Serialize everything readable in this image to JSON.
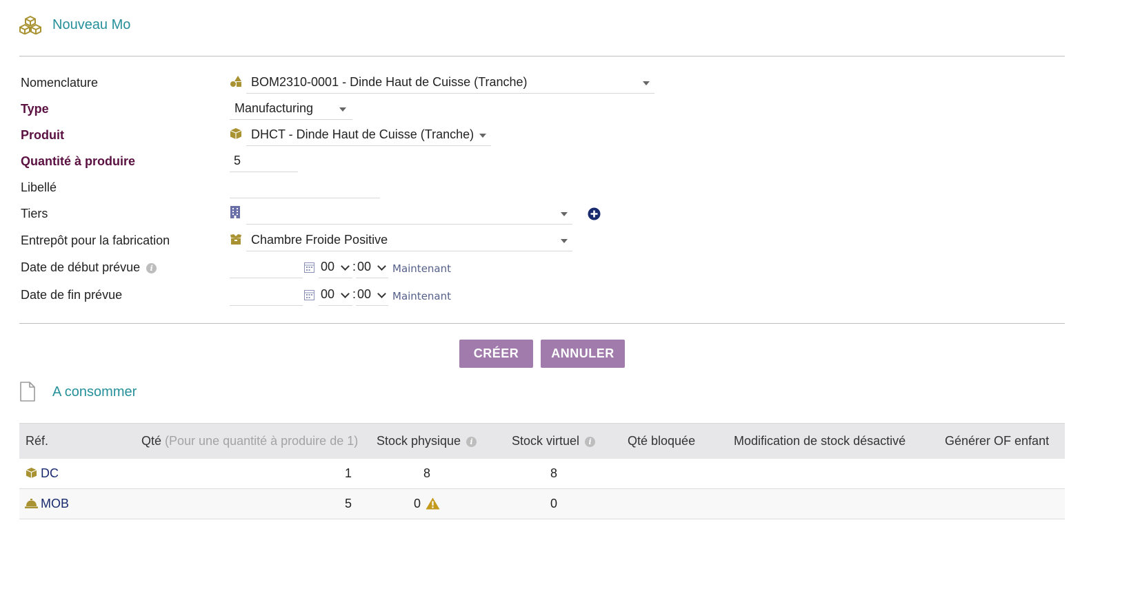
{
  "header": {
    "title": "Nouveau Mo"
  },
  "form": {
    "nomenclature": {
      "label": "Nomenclature",
      "value": "BOM2310-0001 - Dinde Haut de Cuisse (Tranche)"
    },
    "type": {
      "label": "Type",
      "value": "Manufacturing"
    },
    "produit": {
      "label": "Produit",
      "value": "DHCT - Dinde Haut de Cuisse (Tranche)"
    },
    "quantite": {
      "label": "Quantité à produire",
      "value": "5"
    },
    "libelle": {
      "label": "Libellé",
      "value": ""
    },
    "tiers": {
      "label": "Tiers",
      "value": ""
    },
    "entrepot": {
      "label": "Entrepôt pour la fabrication",
      "value": "Chambre Froide Positive"
    },
    "date_debut": {
      "label": "Date de début prévue",
      "hour": "00",
      "minute": "00",
      "now_label": "Maintenant"
    },
    "date_fin": {
      "label": "Date de fin prévue",
      "hour": "00",
      "minute": "00",
      "now_label": "Maintenant"
    }
  },
  "buttons": {
    "create": "CRÉER",
    "cancel": "ANNULER"
  },
  "consume_section": {
    "title": "A consommer"
  },
  "table": {
    "headers": {
      "ref": "Réf.",
      "qty": "Qté",
      "qty_note": "(Pour une quantité à produire de 1)",
      "stock_physique": "Stock physique",
      "stock_virtuel": "Stock virtuel",
      "qty_bloquee": "Qté bloquée",
      "modif_stock": "Modification de stock désactivé",
      "generer_of": "Générer OF enfant"
    },
    "rows": [
      {
        "ref": "DC",
        "qty": "1",
        "stock_physique": "8",
        "stock_virtuel": "8",
        "icon": "product-box-icon",
        "warning": false
      },
      {
        "ref": "MOB",
        "qty": "5",
        "stock_physique": "0",
        "stock_virtuel": "0",
        "icon": "service-bell-icon",
        "warning": true
      }
    ]
  },
  "colors": {
    "accent": "#25909a",
    "button": "#a07bac",
    "required_label": "#5a1040",
    "icon_gold": "#a89232",
    "warning": "#c39a1c"
  }
}
